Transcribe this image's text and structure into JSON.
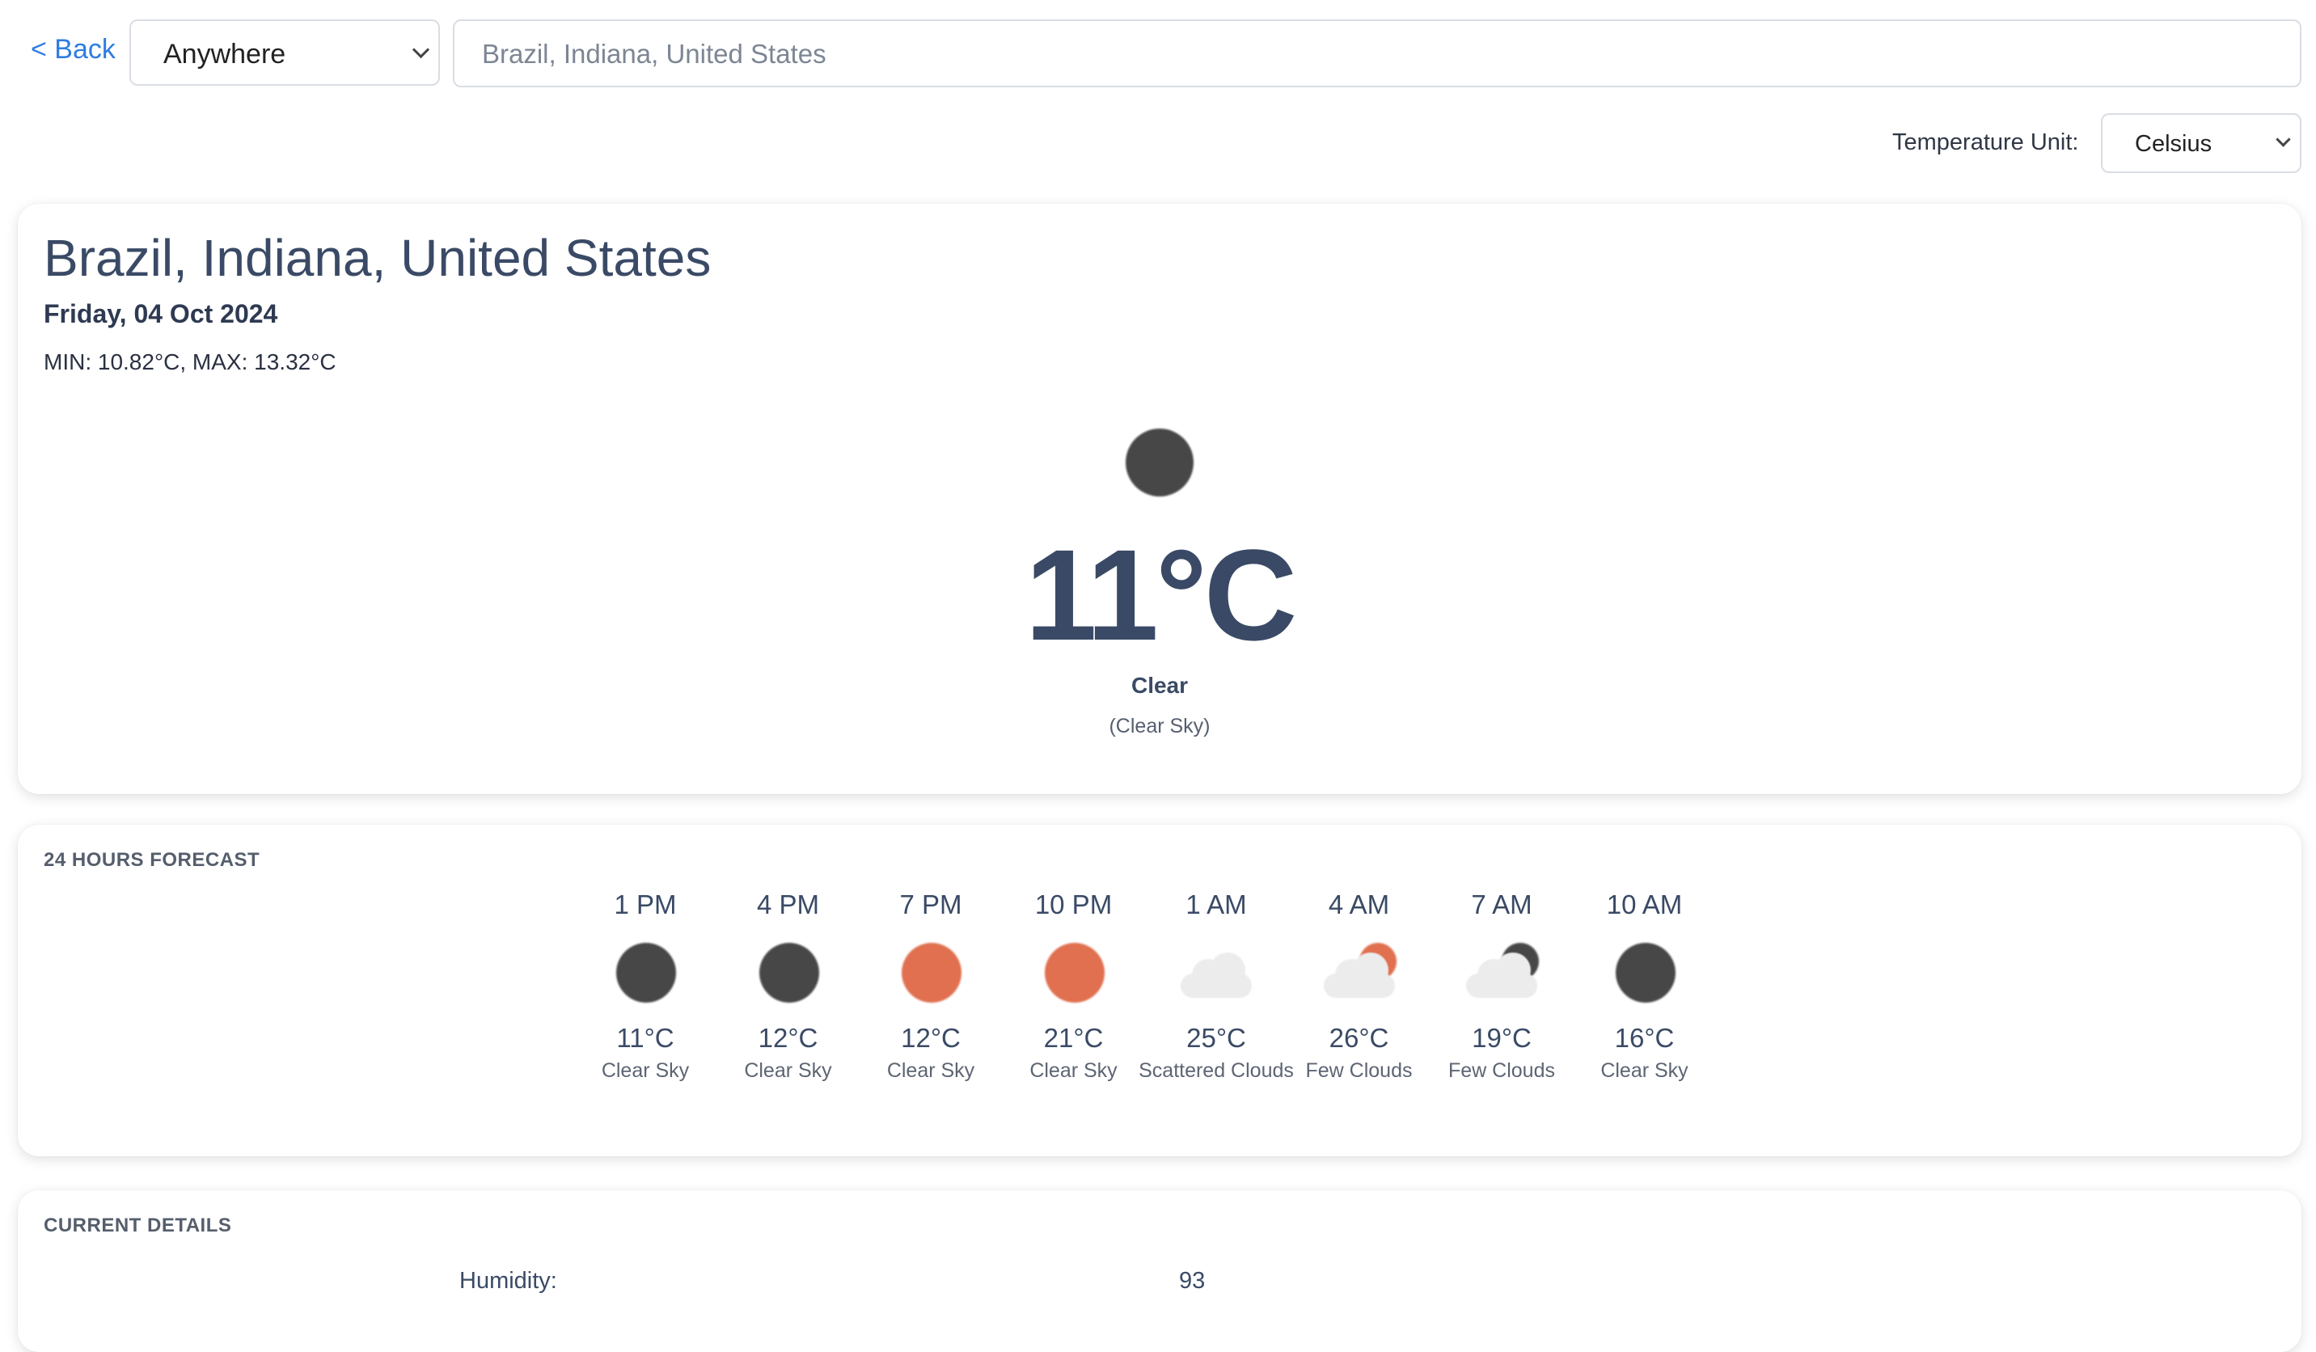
{
  "nav": {
    "back_label": "< Back",
    "scope_select": "Anywhere",
    "search_value": "Brazil, Indiana, United States"
  },
  "units": {
    "label": "Temperature Unit:",
    "selected": "Celsius"
  },
  "current": {
    "city": "Brazil, Indiana, United States",
    "date": "Friday, 04 Oct 2024",
    "minmax": "MIN: 10.82°C, MAX: 13.32°C",
    "icon": "clear-night-icon",
    "temp": "11°C",
    "condition": "Clear",
    "description": "(Clear Sky)"
  },
  "forecast": {
    "title": "24 HOURS FORECAST",
    "hours": [
      {
        "time": "1 PM",
        "temp": "11°C",
        "cond": "Clear Sky",
        "icon": "moon-icon"
      },
      {
        "time": "4 PM",
        "temp": "12°C",
        "cond": "Clear Sky",
        "icon": "moon-icon"
      },
      {
        "time": "7 PM",
        "temp": "12°C",
        "cond": "Clear Sky",
        "icon": "sun-icon"
      },
      {
        "time": "10 PM",
        "temp": "21°C",
        "cond": "Clear Sky",
        "icon": "sun-icon"
      },
      {
        "time": "1 AM",
        "temp": "25°C",
        "cond": "Scattered Clouds",
        "icon": "cloud-icon"
      },
      {
        "time": "4 AM",
        "temp": "26°C",
        "cond": "Few Clouds",
        "icon": "cloud-sun-icon"
      },
      {
        "time": "7 AM",
        "temp": "19°C",
        "cond": "Few Clouds",
        "icon": "cloud-moon-icon"
      },
      {
        "time": "10 AM",
        "temp": "16°C",
        "cond": "Clear Sky",
        "icon": "moon-icon"
      }
    ]
  },
  "details": {
    "title": "CURRENT DETAILS",
    "humidity_label": "Humidity:",
    "humidity_value": "93"
  },
  "colors": {
    "accent": "#2f7de1",
    "text": "#3a4a66",
    "moon": "#474747",
    "sun": "#e0704f",
    "cloud": "#ececec"
  }
}
